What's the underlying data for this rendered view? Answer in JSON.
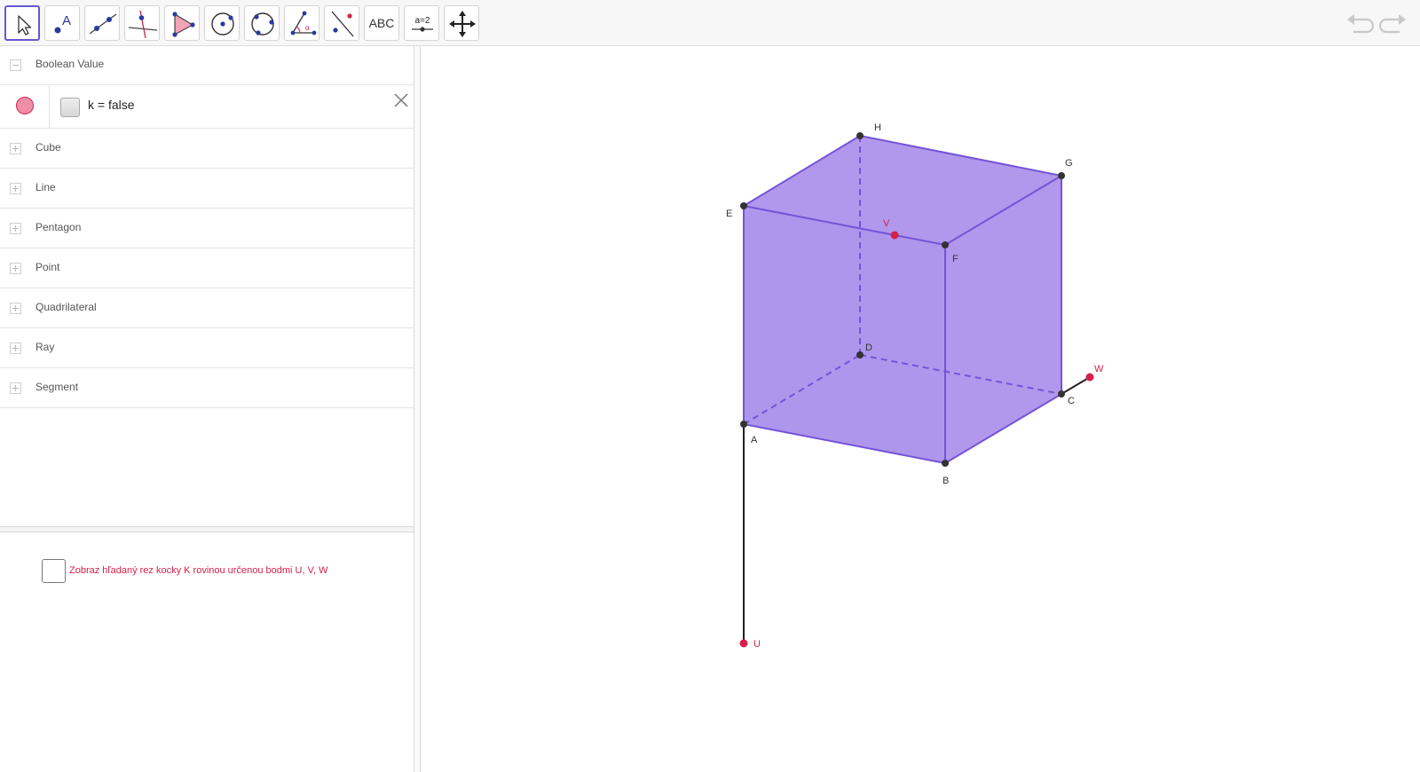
{
  "toolbar": {
    "tools": [
      {
        "id": "move",
        "icon": "cursor-arrow-icon"
      },
      {
        "id": "point",
        "icon": "point-icon"
      },
      {
        "id": "line",
        "icon": "line-icon"
      },
      {
        "id": "perpendicular",
        "icon": "perpendicular-line-icon"
      },
      {
        "id": "polygon",
        "icon": "polygon-icon"
      },
      {
        "id": "circle",
        "icon": "circle-center-point-icon"
      },
      {
        "id": "circle3",
        "icon": "circle-three-points-icon"
      },
      {
        "id": "angle",
        "icon": "angle-icon"
      },
      {
        "id": "reflect",
        "icon": "reflect-line-icon"
      },
      {
        "id": "text",
        "label": "ABC"
      },
      {
        "id": "slider",
        "label": "a=2"
      },
      {
        "id": "move-view",
        "icon": "move-graphics-icon"
      }
    ],
    "undo_icon": "undo-icon",
    "redo_icon": "redo-icon"
  },
  "algebra": {
    "groups": [
      {
        "label": "Boolean Value",
        "expanded": true
      },
      {
        "label": "Cube",
        "expanded": false
      },
      {
        "label": "Line",
        "expanded": false
      },
      {
        "label": "Pentagon",
        "expanded": false
      },
      {
        "label": "Point",
        "expanded": false
      },
      {
        "label": "Quadrilateral",
        "expanded": false
      },
      {
        "label": "Ray",
        "expanded": false
      },
      {
        "label": "Segment",
        "expanded": false
      }
    ],
    "item": {
      "expression": "k = false",
      "checked": false,
      "marble_color": "#ef8ea7"
    }
  },
  "section_checkbox": {
    "label": "Zobraz hľadaný rez kocky K rovinou určenou bodmi U, V, W",
    "checked": false
  },
  "graphics": {
    "points": [
      {
        "name": "A",
        "color": "#333333"
      },
      {
        "name": "B",
        "color": "#333333"
      },
      {
        "name": "C",
        "color": "#333333"
      },
      {
        "name": "D",
        "color": "#333333"
      },
      {
        "name": "E",
        "color": "#333333"
      },
      {
        "name": "F",
        "color": "#333333"
      },
      {
        "name": "G",
        "color": "#333333"
      },
      {
        "name": "H",
        "color": "#333333"
      },
      {
        "name": "U",
        "color": "#d4204a"
      },
      {
        "name": "V",
        "color": "#d4204a"
      },
      {
        "name": "W",
        "color": "#d4204a"
      }
    ],
    "cube_color": "#9c7ee8",
    "edge_color": "#7553d8"
  }
}
